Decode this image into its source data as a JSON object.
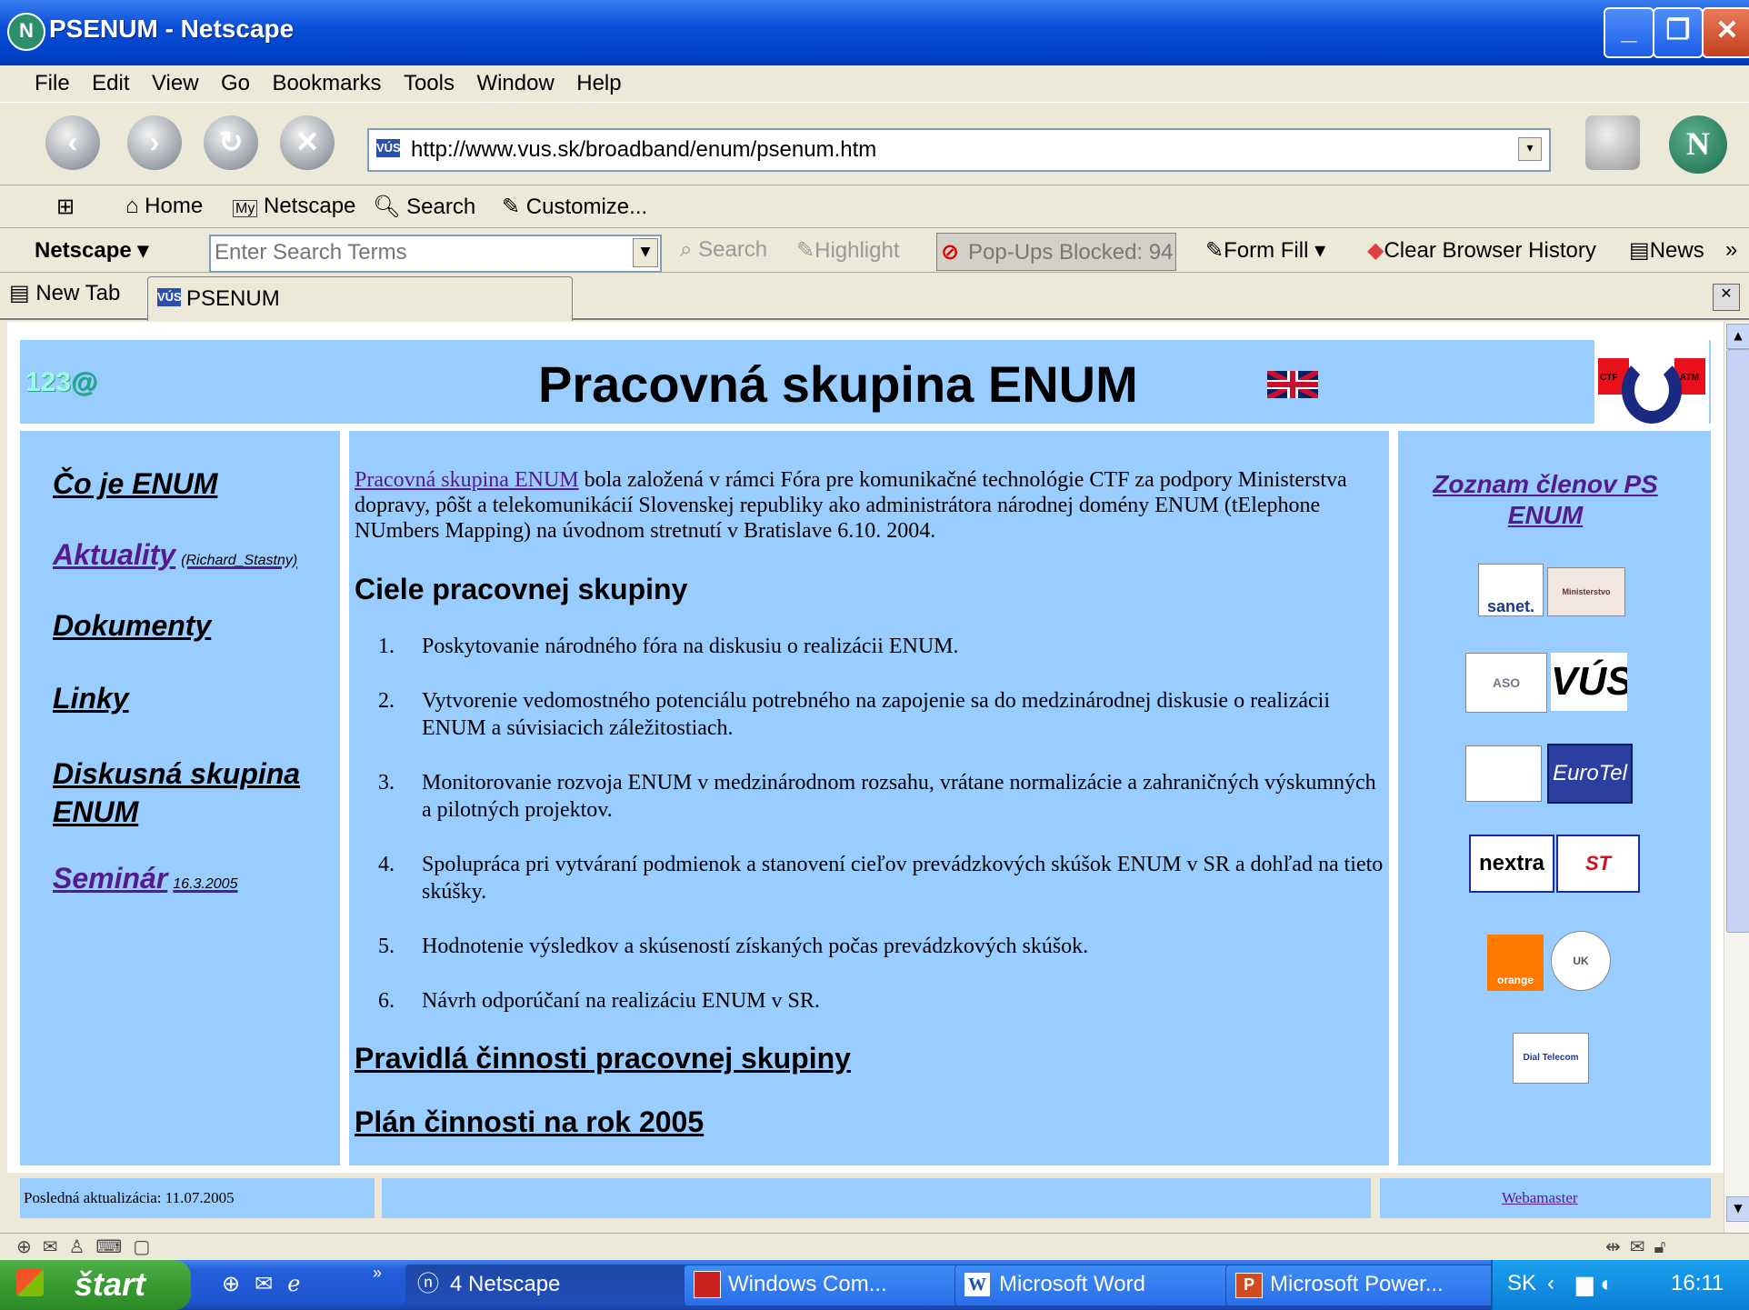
{
  "window": {
    "title": "PSENUM - Netscape",
    "app_icon": "netscape-icon"
  },
  "menu": [
    "File",
    "Edit",
    "View",
    "Go",
    "Bookmarks",
    "Tools",
    "Window",
    "Help"
  ],
  "nav": {
    "back_icon": "back-arrow-icon",
    "forward_icon": "forward-arrow-icon",
    "reload_icon": "reload-icon",
    "stop_icon": "stop-icon",
    "url": "http://www.vus.sk/broadband/enum/psenum.htm",
    "url_favicon": "VÚS"
  },
  "personal_toolbar": {
    "home": "Home",
    "my_netscape": "Netscape",
    "my_badge": "My",
    "search": "Search",
    "customize": "Customize..."
  },
  "netscape_toolbar": {
    "netscape": "Netscape",
    "search_placeholder": "Enter Search Terms",
    "search_btn": "Search",
    "highlight": "Highlight",
    "popups": "Pop-Ups Blocked: 94",
    "form_fill": "Form Fill",
    "clear_history": "Clear Browser History",
    "news": "News",
    "more": "»"
  },
  "tabs": [
    {
      "label": "New Tab"
    },
    {
      "label": "PSENUM",
      "favicon": "VÚS"
    }
  ],
  "page": {
    "heading": "Pracovná skupina ENUM",
    "counter": "123",
    "counter_at": "@",
    "ctf_logo_small": "CTF",
    "ctf_logo_right": "ATM",
    "left_nav": [
      {
        "label": "Čo je ENUM"
      },
      {
        "label": "Aktuality",
        "note": "(Richard_Stastny)"
      },
      {
        "label": "Dokumenty"
      },
      {
        "label": "Linky"
      },
      {
        "label": "Diskusná skupina ENUM"
      },
      {
        "label": "Seminár",
        "note": "16.3.2005"
      }
    ],
    "intro_link": "Pracovná skupina ENUM",
    "intro_text": " bola založená v rámci Fóra pre komunikačné technológie CTF za podpory Ministerstva dopravy, pôšt a telekomunikácií Slovenskej republiky ako administrátora národnej domény ENUM (tElephone  NUmbers  Mapping) na úvodnom stretnutí   v Bratislave 6.10. 2004.",
    "goals_heading": "Ciele pracovnej skupiny",
    "goals": [
      "Poskytovanie národného fóra na diskusiu o realizácii ENUM.",
      "Vytvorenie vedomostného potenciálu  potrebného na zapojenie sa do medzinárodnej diskusie o realizácii ENUM a súvisiacich záležitostiach.",
      "Monitorovanie rozvoja ENUM v medzinárodnom rozsahu, vrátane normalizácie a zahraničných výskumných a pilotných projektov.",
      "Spolupráca pri vytváraní podmienok a stanovení cieľov prevádzkových skúšok ENUM v SR a dohľad na tieto skúšky.",
      "Hodnotenie výsledkov a skúseností získaných počas prevádzkových skúšok.",
      "Návrh odporúčaní na realizáciu ENUM v SR."
    ],
    "link_rules": "Pravidlá činnosti pracovnej skupiny",
    "link_plan": "Plán činnosti na rok 2005",
    "members_link": "Zoznam členov PS ENUM",
    "logos": [
      "sanet.",
      "Ministerstvo",
      "ASO",
      "VÚS",
      "EuroTel",
      "nextra",
      "ST",
      "orange",
      "UK",
      "Dial Telecom"
    ],
    "footer_updated": "Posledná aktualizácia: 11.07.2005",
    "footer_webmaster": "Webamaster"
  },
  "taskbar": {
    "start": "štart",
    "items": [
      "4 Netscape",
      "Windows Com...",
      "Microsoft Word",
      "Microsoft Power..."
    ],
    "lang": "SK",
    "clock": "16:11",
    "chevron": "»"
  },
  "colors": {
    "page_bg": "#99ccff",
    "link_visited": "#551a8b",
    "xp_blue": "#0a4fd8",
    "start_green": "#379c31"
  }
}
